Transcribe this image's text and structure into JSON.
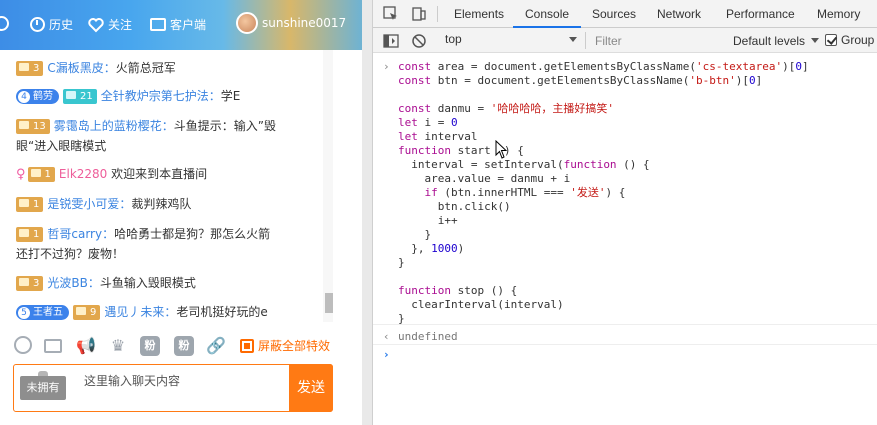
{
  "topbar": {
    "history_label": "历史",
    "follow_label": "关注",
    "client_label": "客户端",
    "username": "sunshine0017"
  },
  "chat": {
    "messages": [
      {
        "badge": "3",
        "user": "C漏板黑皮：",
        "text": "火箭总冠军"
      },
      {
        "rank": "4",
        "rank_name": "鹤劳",
        "badge2": "21",
        "user": "全针教炉宗第七护法：",
        "text": "学E"
      },
      {
        "badge": "13",
        "user": "雾霭岛上的蓝粉樱花：",
        "text": "斗鱼提示：输入”毁",
        "text2": "眼“进入眼瞎模式"
      },
      {
        "badge": "1",
        "user": "Elk2280",
        "text": "欢迎来到本直播间"
      },
      {
        "badge": "1",
        "user": "是锐雯小可爱：",
        "text": "裁判辣鸡队"
      },
      {
        "badge": "1",
        "user": "哲哥carry：",
        "text": "哈哈勇士都是狗？那怎么火箭",
        "text2": "还打不过狗？废物！"
      },
      {
        "badge": "3",
        "user": "光波BB：",
        "text": "斗鱼输入毁眼模式"
      },
      {
        "rank": "5",
        "rank_name": "王者五",
        "badge": "9",
        "user": "遇见丿未来：",
        "text": "老司机挺好玩的e"
      }
    ],
    "toolbar": {
      "hide_effects_label": "屏蔽全部特效",
      "tool_box1": "粉",
      "tool_box2": "粉"
    },
    "input": {
      "not_owned": "未拥有",
      "placeholder": "这里输入聊天内容",
      "send_label": "发送"
    }
  },
  "devtools": {
    "tabs": [
      "Elements",
      "Console",
      "Sources",
      "Network",
      "Performance",
      "Memory"
    ],
    "active_tab": "Console",
    "context": "top",
    "filter_placeholder": "Filter",
    "levels_label": "Default levels",
    "group_label": "Group",
    "code": [
      [
        {
          "t": "const ",
          "c": "kw"
        },
        {
          "t": "area = document.getElementsByClassName(",
          "c": ""
        },
        {
          "t": "'cs-textarea'",
          "c": "str"
        },
        {
          "t": ")[",
          "c": ""
        },
        {
          "t": "0",
          "c": "num"
        },
        {
          "t": "]",
          "c": ""
        }
      ],
      [
        {
          "t": "const ",
          "c": "kw"
        },
        {
          "t": "btn = document.getElementsByClassName(",
          "c": ""
        },
        {
          "t": "'b-btn'",
          "c": "str"
        },
        {
          "t": ")[",
          "c": ""
        },
        {
          "t": "0",
          "c": "num"
        },
        {
          "t": "]",
          "c": ""
        }
      ],
      [],
      [
        {
          "t": "const ",
          "c": "kw"
        },
        {
          "t": "danmu = ",
          "c": ""
        },
        {
          "t": "'哈哈哈哈，主播好搞笑'",
          "c": "str"
        }
      ],
      [
        {
          "t": "let ",
          "c": "kw"
        },
        {
          "t": "i = ",
          "c": ""
        },
        {
          "t": "0",
          "c": "num"
        }
      ],
      [
        {
          "t": "let ",
          "c": "kw"
        },
        {
          "t": "interval",
          "c": ""
        }
      ],
      [
        {
          "t": "function ",
          "c": "kw"
        },
        {
          "t": "start () {",
          "c": ""
        }
      ],
      [
        {
          "t": "  interval = setInterval(",
          "c": ""
        },
        {
          "t": "function",
          "c": "kw"
        },
        {
          "t": " () {",
          "c": ""
        }
      ],
      [
        {
          "t": "    area.value = danmu + i",
          "c": ""
        }
      ],
      [
        {
          "t": "    ",
          "c": ""
        },
        {
          "t": "if",
          "c": "kw"
        },
        {
          "t": " (btn.innerHTML === ",
          "c": ""
        },
        {
          "t": "'发送'",
          "c": "str"
        },
        {
          "t": ") {",
          "c": ""
        }
      ],
      [
        {
          "t": "      btn.click()",
          "c": ""
        }
      ],
      [
        {
          "t": "      i++",
          "c": ""
        }
      ],
      [
        {
          "t": "    }",
          "c": ""
        }
      ],
      [
        {
          "t": "  }, ",
          "c": ""
        },
        {
          "t": "1000",
          "c": "num"
        },
        {
          "t": ")",
          "c": ""
        }
      ],
      [
        {
          "t": "}",
          "c": ""
        }
      ],
      [],
      [
        {
          "t": "function ",
          "c": "kw"
        },
        {
          "t": "stop () {",
          "c": ""
        }
      ],
      [
        {
          "t": "  clearInterval(interval)",
          "c": ""
        }
      ],
      [
        {
          "t": "}",
          "c": ""
        }
      ]
    ],
    "result": "undefined"
  }
}
